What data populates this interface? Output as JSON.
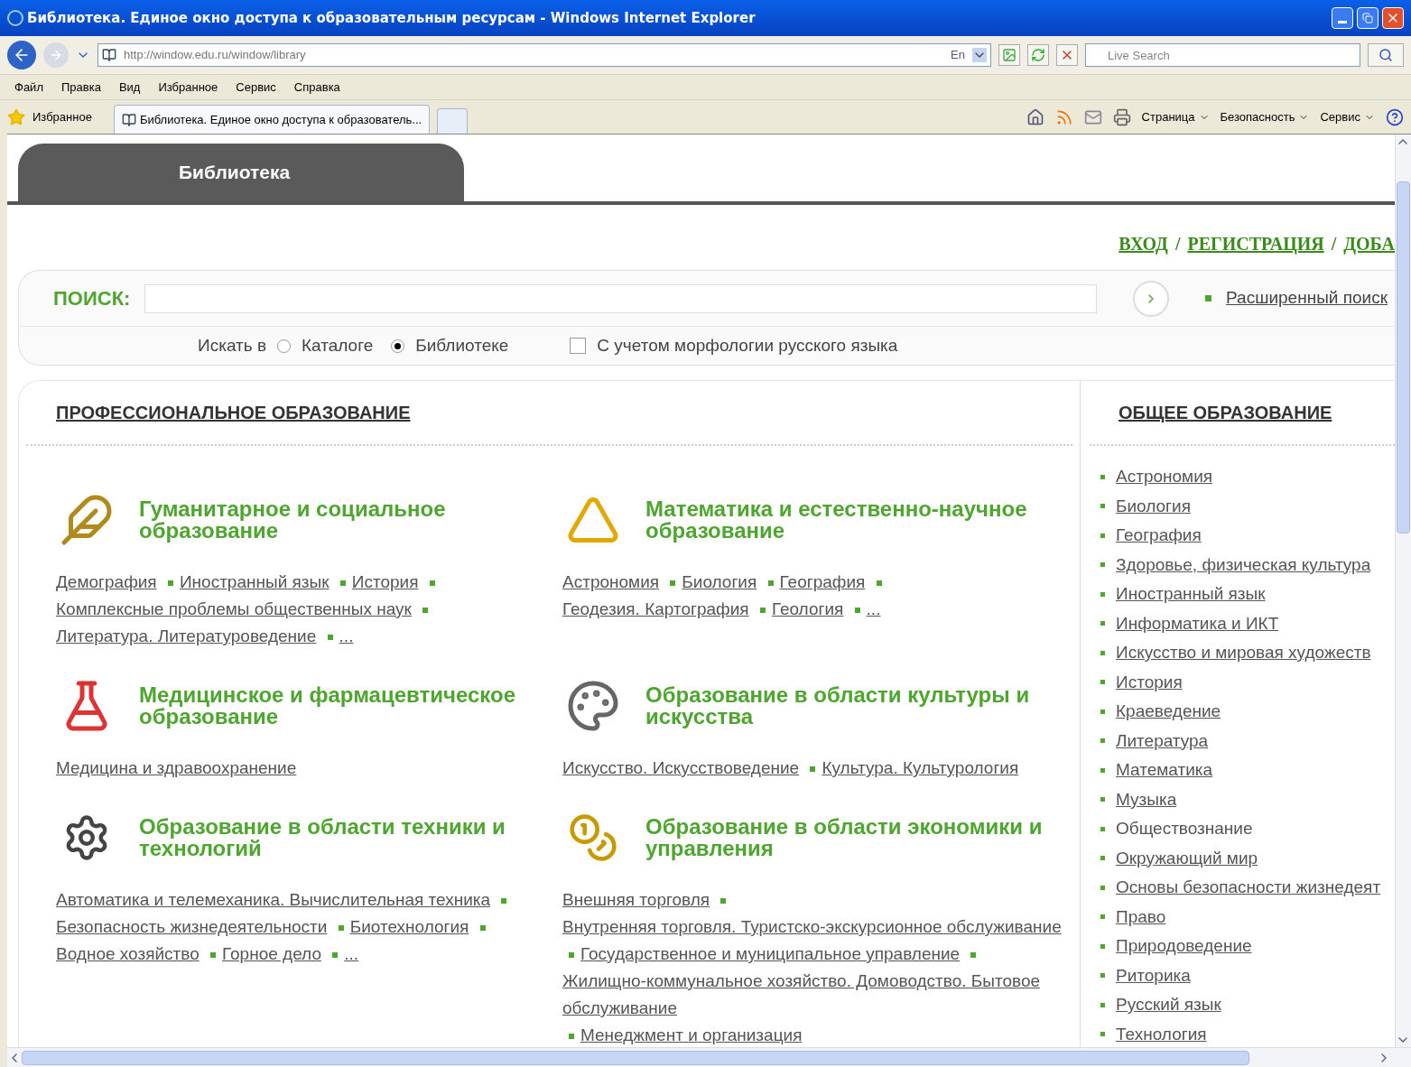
{
  "window": {
    "title": "Библиотека. Единое окно доступа к образовательным ресурсам - Windows Internet Explorer"
  },
  "address_bar": {
    "url": "http://window.edu.ru/window/library",
    "language": "En",
    "search_placeholder": "Live Search"
  },
  "menu": [
    "Файл",
    "Правка",
    "Вид",
    "Избранное",
    "Сервис",
    "Справка"
  ],
  "favorites_bar": {
    "favorites": "Избранное",
    "tabs": [
      {
        "label": "Библиотека. Единое окно доступа к образователь...",
        "selected": true
      }
    ]
  },
  "command_bar": [
    "Страница",
    "Безопасность",
    "Сервис"
  ],
  "page": {
    "site_tab": "Библиотека",
    "auth_links": [
      {
        "kind": "link",
        "text": "ВХОД"
      },
      {
        "kind": "separator",
        "text": "/"
      },
      {
        "kind": "link",
        "text": "РЕГИСТРАЦИЯ"
      },
      {
        "kind": "separator",
        "text": "/"
      },
      {
        "kind": "link",
        "text": "ДОБА"
      }
    ],
    "search": {
      "label": "ПОИСК:",
      "advanced": "Расширенный поиск",
      "scope_label": "Искать в",
      "options": [
        {
          "label": "Каталоге",
          "selected": false
        },
        {
          "label": "Библиотеке",
          "selected": true
        }
      ],
      "morphology": {
        "label": "С учетом морфологии русского языка",
        "checked": false
      }
    },
    "professional": {
      "heading": "ПРОФЕССИОНАЛЬНОЕ ОБРАЗОВАНИЕ",
      "categories": [
        {
          "kind": "quill",
          "title": "Гуманитарное и социальное образование",
          "links": [
            "Демография",
            "Иностранный язык",
            "История",
            "Комплексные проблемы общественных наук",
            "Литература. Литературоведение",
            "..."
          ]
        },
        {
          "kind": "math",
          "title": "Математика и естественно-научное образование",
          "links": [
            "Астрономия",
            "Биология",
            "География",
            "Геодезия. Картография",
            "Геология",
            "..."
          ]
        },
        {
          "kind": "medicine",
          "title": "Медицинское и фармацевтическое образование",
          "links": [
            "Медицина и здравоохранение"
          ]
        },
        {
          "kind": "art",
          "title": "Образование в области культуры и искусства",
          "links": [
            "Искусство. Искусствоведение",
            "Культура. Культурология"
          ]
        },
        {
          "kind": "tech",
          "title": "Образование в области техники и технологий",
          "links": [
            "Автоматика и телемеханика. Вычислительная техника",
            "Безопасность жизнедеятельности",
            "Биотехнология",
            "Водное хозяйство",
            "Горное дело",
            "..."
          ]
        },
        {
          "kind": "economics",
          "title": "Образование в области экономики и управления",
          "links": [
            "Внешняя торговля",
            "Внутренняя торговля. Туристско-экскурсионное обслуживание",
            "Государственное и муниципальное управление",
            "Жилищно-коммунальное хозяйство. Домоводство. Бытовое обслуживание",
            "Менеджмент и организация"
          ]
        }
      ]
    },
    "general": {
      "heading": "ОБЩЕЕ ОБРАЗОВАНИЕ",
      "items": [
        {
          "label": "Астрономия",
          "linked": true
        },
        {
          "label": "Биология",
          "linked": true
        },
        {
          "label": "География",
          "linked": true
        },
        {
          "label": "Здоровье, физическая культура",
          "linked": true
        },
        {
          "label": "Иностранный язык",
          "linked": true
        },
        {
          "label": "Информатика и ИКТ",
          "linked": true
        },
        {
          "label": "Искусство и мировая художеств",
          "linked": true
        },
        {
          "label": "История",
          "linked": true
        },
        {
          "label": "Краеведение",
          "linked": true
        },
        {
          "label": "Литература",
          "linked": true
        },
        {
          "label": "Математика",
          "linked": true
        },
        {
          "label": "Музыка",
          "linked": true
        },
        {
          "label": "Обществознание",
          "linked": false
        },
        {
          "label": "Окружающий мир",
          "linked": true
        },
        {
          "label": "Основы безопасности жизнедеят",
          "linked": true
        },
        {
          "label": "Право",
          "linked": true
        },
        {
          "label": "Природоведение",
          "linked": true
        },
        {
          "label": "Риторика",
          "linked": true
        },
        {
          "label": "Русский язык",
          "linked": true
        },
        {
          "label": "Технология",
          "linked": true
        }
      ]
    }
  }
}
